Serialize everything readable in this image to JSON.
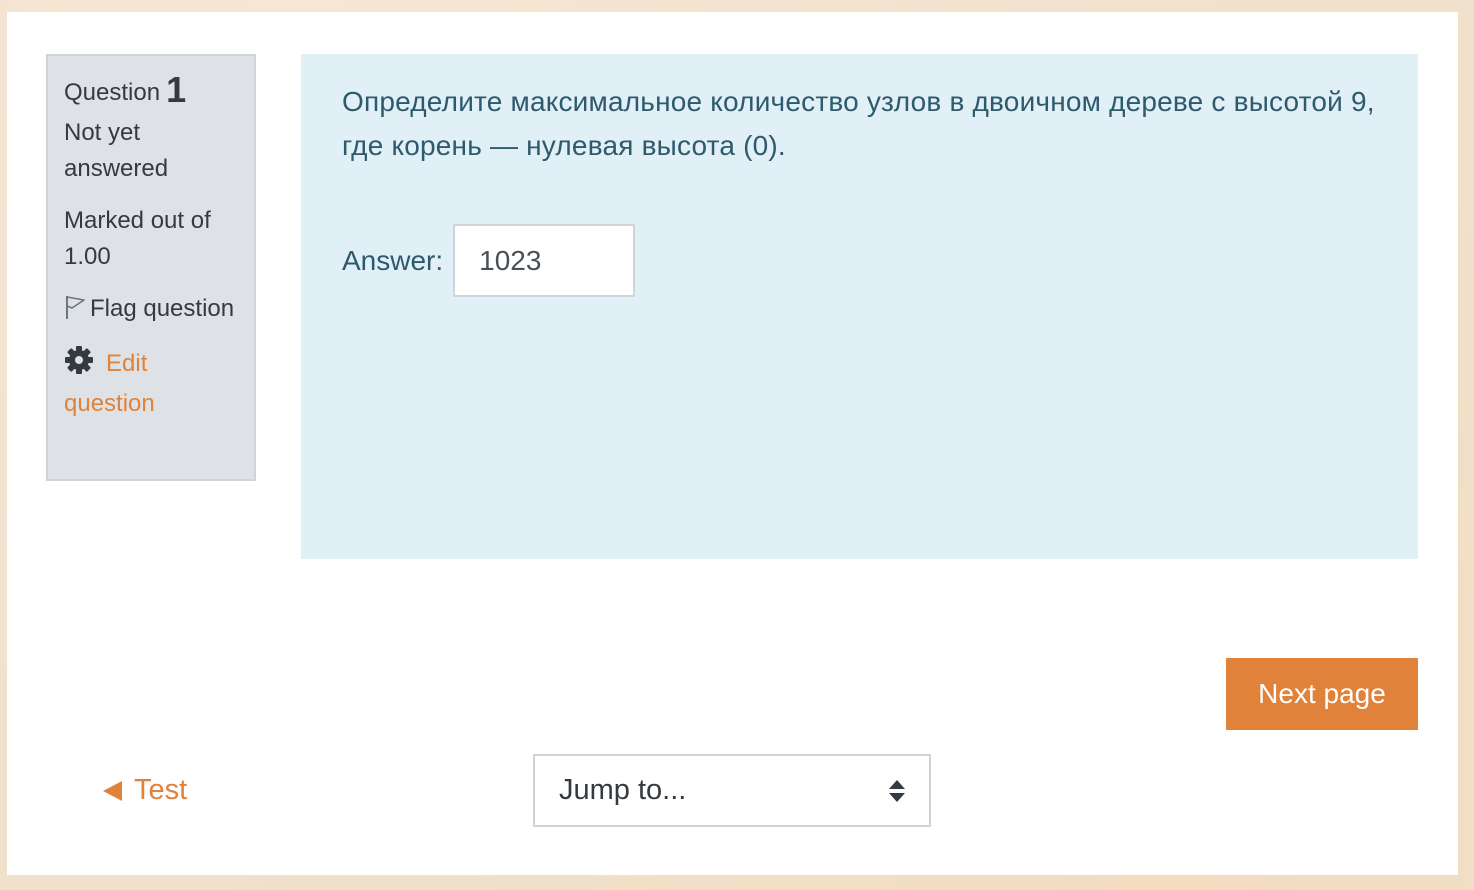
{
  "question_info": {
    "question_word": "Question",
    "question_number": "1",
    "status": "Not yet answered",
    "marked_out_of": "Marked out of 1.00",
    "flag_label": "Flag question",
    "edit_label": "Edit question"
  },
  "question": {
    "text": "Определите максимальное количество узлов в двоичном дереве с высотой 9, где корень — нулевая высота (0).",
    "answer_label": "Answer:",
    "answer_value": "1023"
  },
  "navigation": {
    "next_page_label": "Next page",
    "back_link_label": "Test",
    "jump_to_label": "Jump to..."
  },
  "colors": {
    "accent": "#e0823a",
    "info_bg": "#dee2e6",
    "content_bg": "#e1eff7",
    "question_text": "#2d5b6d"
  },
  "icons": {
    "flag": "flag-outline-icon",
    "edit": "gear-icon",
    "back": "triangle-left-icon",
    "select": "updown-icon"
  }
}
